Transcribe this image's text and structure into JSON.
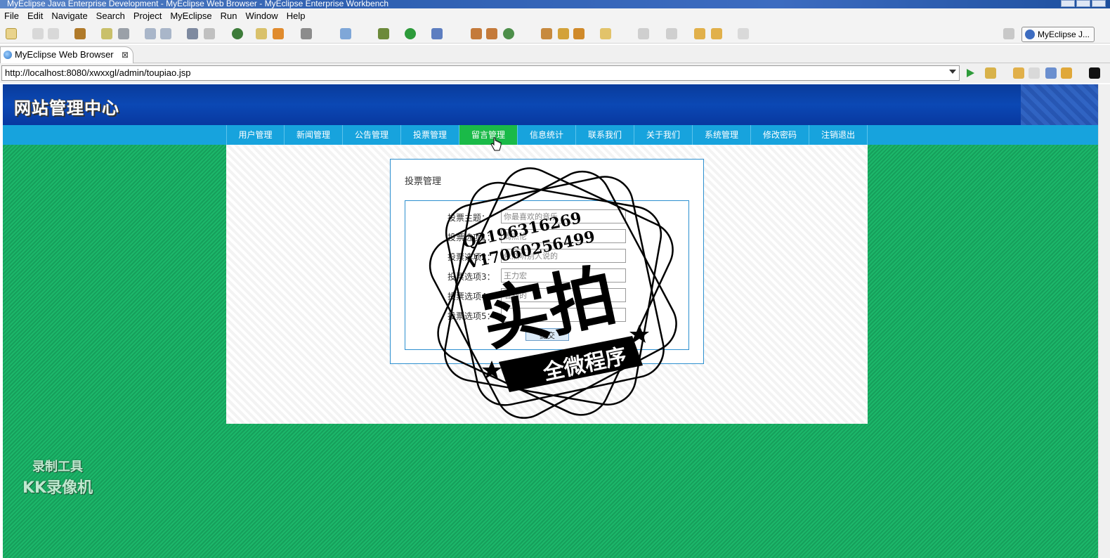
{
  "window": {
    "title": "MyEclipse Java Enterprise Development - MyEclipse Web Browser - MyEclipse Enterprise Workbench"
  },
  "menu": [
    "File",
    "Edit",
    "Navigate",
    "Search",
    "Project",
    "MyEclipse",
    "Run",
    "Window",
    "Help"
  ],
  "perspective": {
    "label": "MyEclipse J..."
  },
  "tab": {
    "label": "MyEclipse Web Browser",
    "close": "⊠"
  },
  "address": {
    "url": "http://localhost:8080/xwxxgl/admin/toupiao.jsp"
  },
  "site": {
    "title": "网站管理中心",
    "nav": [
      "用户管理",
      "新闻管理",
      "公告管理",
      "投票管理",
      "留言管理",
      "信息统计",
      "联系我们",
      "关于我们",
      "系统管理",
      "修改密码",
      "注销退出"
    ],
    "active_nav": "留言管理"
  },
  "form": {
    "heading": "投票管理",
    "fields": [
      {
        "label": "投票主题：",
        "value": "你最喜欢的音乐"
      },
      {
        "label": "投票选项1：",
        "value": "周杰伦"
      },
      {
        "label": "投票选项2：",
        "value": "依然听别人说的"
      },
      {
        "label": "投票选项3：",
        "value": "王力宏"
      },
      {
        "label": "投票选项4：",
        "value": "看到的"
      },
      {
        "label": "投票选项5：",
        "value": ""
      }
    ],
    "submit": "提交"
  },
  "watermark": {
    "qq": "Q2196316269",
    "wx": "V17060256499",
    "big": "实拍",
    "banner": "全微程序"
  },
  "recorder": {
    "line1": "录制工具",
    "line2": "KK录像机"
  }
}
